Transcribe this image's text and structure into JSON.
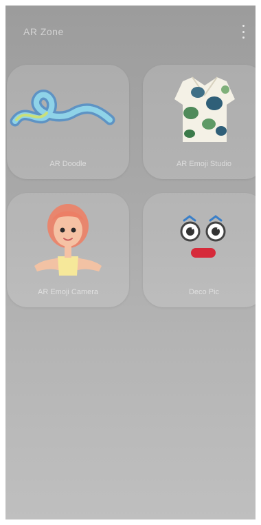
{
  "app": {
    "title": "AR Zone"
  },
  "menu": {
    "icon": "more-options-icon"
  },
  "cards": [
    {
      "label": "AR Doodle",
      "icon": "doodle-icon"
    },
    {
      "label": "AR Emoji Studio",
      "icon": "emoji-studio-icon"
    },
    {
      "label": "AR Emoji Camera",
      "icon": "emoji-camera-icon"
    },
    {
      "label": "Deco Pic",
      "icon": "deco-pic-icon"
    }
  ]
}
